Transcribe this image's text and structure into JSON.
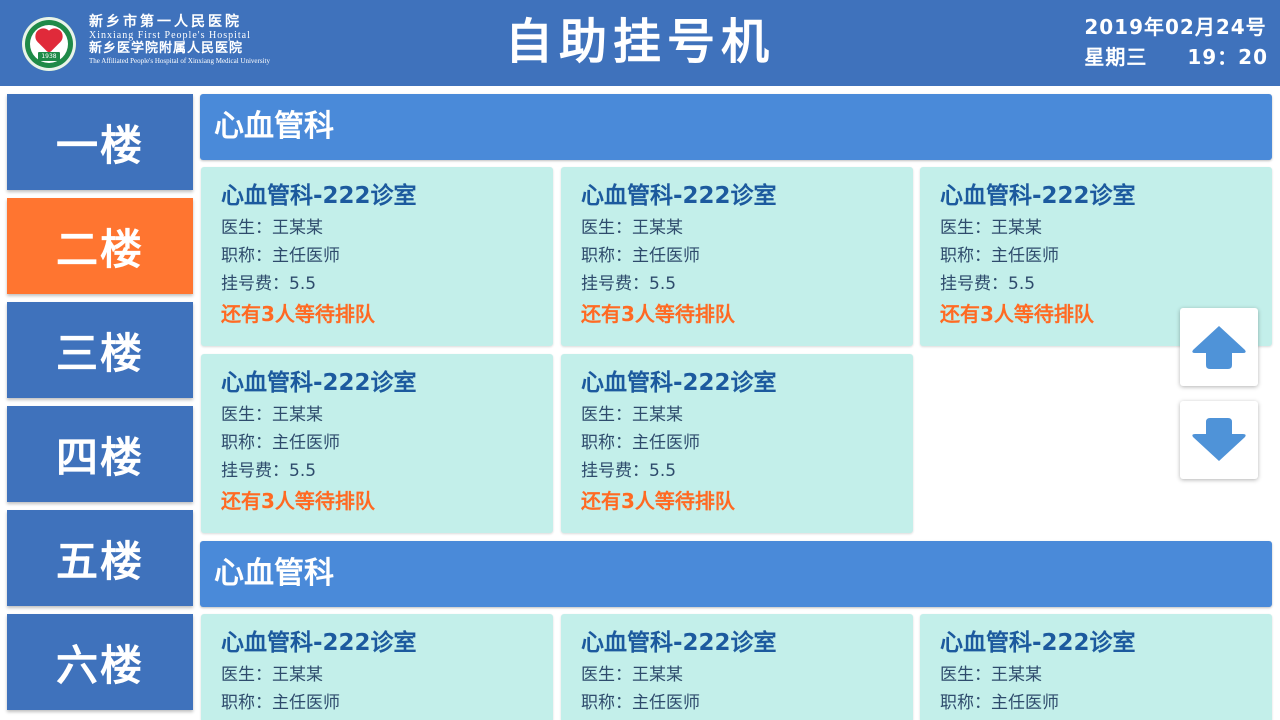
{
  "header": {
    "hospital_name_cn": "新乡市第一人民医院",
    "hospital_name_en": "Xinxiang First People's Hospital",
    "affiliation_cn": "新乡医学院附属人民医院",
    "affiliation_en": "The Affiliated People's Hospital of Xinxiang Medical University",
    "logo_year": "1938",
    "title": "自助挂号机",
    "date": "2019年02月24号",
    "weekday": "星期三",
    "time": "19：20"
  },
  "floors": [
    {
      "label": "一楼",
      "active": false
    },
    {
      "label": "二楼",
      "active": true
    },
    {
      "label": "三楼",
      "active": false
    },
    {
      "label": "四楼",
      "active": false
    },
    {
      "label": "五楼",
      "active": false
    },
    {
      "label": "六楼",
      "active": false
    }
  ],
  "sections": [
    {
      "department": "心血管科",
      "rooms": [
        {
          "title": "心血管科-222诊室",
          "doctor": "医生：王某某",
          "rank": "职称：主任医师",
          "fee": "挂号费：5.5",
          "queue": "还有3人等待排队"
        },
        {
          "title": "心血管科-222诊室",
          "doctor": "医生：王某某",
          "rank": "职称：主任医师",
          "fee": "挂号费：5.5",
          "queue": "还有3人等待排队"
        },
        {
          "title": "心血管科-222诊室",
          "doctor": "医生：王某某",
          "rank": "职称：主任医师",
          "fee": "挂号费：5.5",
          "queue": "还有3人等待排队"
        },
        {
          "title": "心血管科-222诊室",
          "doctor": "医生：王某某",
          "rank": "职称：主任医师",
          "fee": "挂号费：5.5",
          "queue": "还有3人等待排队"
        },
        {
          "title": "心血管科-222诊室",
          "doctor": "医生：王某某",
          "rank": "职称：主任医师",
          "fee": "挂号费：5.5",
          "queue": "还有3人等待排队"
        }
      ]
    },
    {
      "department": "心血管科",
      "rooms": [
        {
          "title": "心血管科-222诊室",
          "doctor": "医生：王某某",
          "rank": "职称：主任医师"
        },
        {
          "title": "心血管科-222诊室",
          "doctor": "医生：王某某",
          "rank": "职称：主任医师"
        },
        {
          "title": "心血管科-222诊室",
          "doctor": "医生：王某某",
          "rank": "职称：主任医师"
        }
      ]
    }
  ],
  "scroll": {
    "up_icon": "arrow-up-icon",
    "down_icon": "arrow-down-icon"
  },
  "colors": {
    "header_bg": "#3f72bc",
    "floor_bg": "#3f72bc",
    "floor_active_bg": "#ff7530",
    "dept_bar_bg": "#4a8ad9",
    "card_bg": "#c3efea",
    "card_title": "#1c5a9e",
    "queue_text": "#ff6a23",
    "arrow": "#4f93d8"
  }
}
